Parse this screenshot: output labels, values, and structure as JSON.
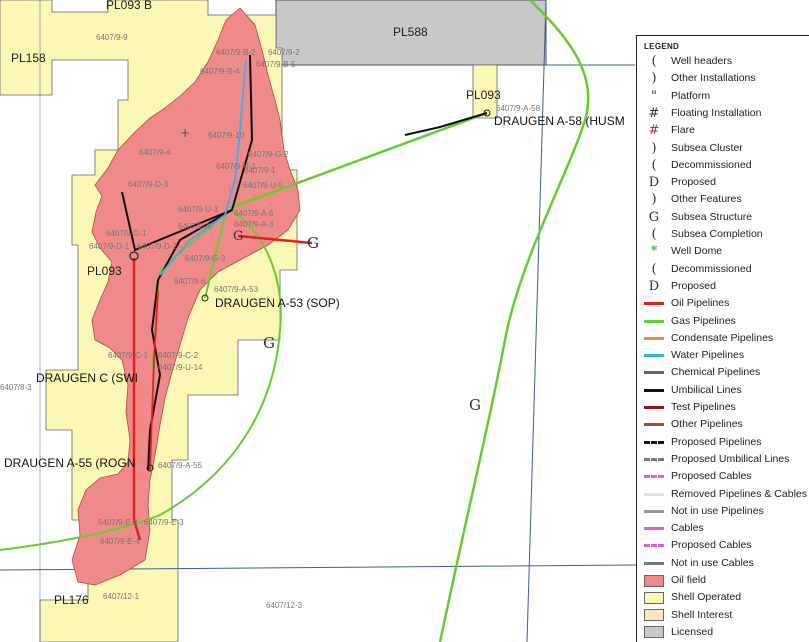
{
  "map": {
    "field_labels": {
      "draugen_a58": "DRAUGEN A-58 (HUSM",
      "draugen_a53": "DRAUGEN A-53  (SOP)",
      "draugen_c": "DRAUGEN C (SWI",
      "draugen_a55": "DRAUGEN A-55  (ROGN"
    },
    "licence_labels": {
      "pl093_top": "PL093 B",
      "pl158": "PL158",
      "pl588": "PL588",
      "pl093_right": "PL093",
      "pl093_left": "PL093",
      "pl176": "PL176"
    },
    "well_labels": {
      "w1": "6407/9-9",
      "w2": "6407/9-B-2",
      "w3": "6407/9-2",
      "w4": "6407/9-B-4",
      "w5": "6407/9-B-5",
      "w6": "6407/9-A-58",
      "w7": "6407/9-10",
      "w8": "6407/9-4",
      "w9": "6407/9-G-2",
      "w10": "6407/9-U-1",
      "w11": "6407/9-1",
      "w12": "6407/9-D-3",
      "w13": "6407/9-U-5",
      "w14": "6407/9-U-3",
      "w15": "6407/9-A-6",
      "w16": "6407/9-A-3",
      "w17": "6407/9-A-",
      "w18": "6407/9-G-1",
      "w19": "6407/9-D-1",
      "w20": "6407/9-D-2",
      "w21": "6407/9-G-3",
      "w22": "6407/9-6",
      "w23": "6407/9-A-53",
      "w24": "6407/9-C-1",
      "w25": "6407/9-C-2",
      "w26": "6407/9-U-14",
      "w27": "6407/8-3",
      "w28": "6407/9-A-55",
      "w29": "6407/9-E-2",
      "w30": "6407/9-E-3",
      "w31": "6407/9-E-4",
      "w32": "6407/12-1",
      "w33": "6407/12-3"
    },
    "subsea_structure_glyph": "G",
    "colors": {
      "oil_field": "#f08a8a",
      "shell_operated": "#fbf7b5",
      "licensed": "#c8c8c8",
      "oil_pipeline": "#e32020",
      "gas_pipeline": "#66cc33",
      "water_pipeline": "#3daee9",
      "umbilical_line": "#111111",
      "grid_line": "#3f5aa8"
    }
  },
  "legend": {
    "title": "LEGEND",
    "items": [
      {
        "label": "Well headers",
        "glyph": "(",
        "icon": "well-header-icon"
      },
      {
        "label": "Other Installations",
        "glyph": ")",
        "icon": "other-installations-icon"
      },
      {
        "label": "Platform",
        "glyph": "\"",
        "icon": "platform-icon"
      },
      {
        "label": "Floating Installation",
        "glyph": "#",
        "icon": "floating-installation-icon"
      },
      {
        "label": "Flare",
        "glyph": "#",
        "color": "#cc2222",
        "icon": "flare-icon"
      },
      {
        "label": "Subsea Cluster",
        "glyph": ")",
        "icon": "subsea-cluster-icon"
      },
      {
        "label": "Decommissioned",
        "glyph": "(",
        "icon": "decommissioned-icon"
      },
      {
        "label": "Proposed",
        "glyph": "D",
        "icon": "proposed-icon"
      },
      {
        "label": "Other Features",
        "glyph": ")",
        "icon": "other-features-icon"
      },
      {
        "label": "Subsea Structure",
        "glyph": "G",
        "icon": "subsea-structure-icon"
      },
      {
        "label": "Subsea Completion",
        "glyph": "(",
        "icon": "subsea-completion-icon"
      },
      {
        "label": "Well Dome",
        "glyph": "*",
        "color": "#2e9e2e",
        "icon": "well-dome-icon"
      },
      {
        "label": "Decommissioned",
        "glyph": "(",
        "icon": "decommissioned-icon"
      },
      {
        "label": "Proposed",
        "glyph": "D",
        "icon": "proposed-icon"
      },
      {
        "label": "Oil Pipelines",
        "line": "#e32020",
        "style": "solid",
        "icon": "oil-pipeline-icon"
      },
      {
        "label": "Gas Pipelines",
        "line": "#66cc33",
        "style": "solid",
        "icon": "gas-pipeline-icon"
      },
      {
        "label": "Condensate Pipelines",
        "line": "#f08a3c",
        "style": "solid",
        "icon": "condensate-pipeline-icon"
      },
      {
        "label": "Water Pipelines",
        "line": "#3daee9",
        "style": "solid",
        "icon": "water-pipeline-icon"
      },
      {
        "label": "Chemical Pipelines",
        "line": "#666666",
        "style": "solid",
        "icon": "chemical-pipeline-icon"
      },
      {
        "label": "Umbilical Lines",
        "line": "#111111",
        "style": "solid",
        "icon": "umbilical-line-icon"
      },
      {
        "label": "Test Pipelines",
        "line": "#8b1a1a",
        "style": "solid",
        "icon": "test-pipeline-icon"
      },
      {
        "label": "Other Pipelines",
        "line": "#a0522d",
        "style": "solid",
        "icon": "other-pipeline-icon"
      },
      {
        "label": "Proposed Pipelines",
        "line": "#111111",
        "style": "dashed",
        "icon": "proposed-pipeline-icon"
      },
      {
        "label": "Proposed Umbilical Lines",
        "line": "#777777",
        "style": "dashed",
        "icon": "proposed-umbilical-icon"
      },
      {
        "label": "Proposed Cables",
        "line": "#e060d0",
        "style": "dashed",
        "icon": "proposed-cable-icon"
      },
      {
        "label": "Removed Pipelines & Cables",
        "line": "#e0e0e0",
        "style": "solid",
        "icon": "removed-pipeline-icon"
      },
      {
        "label": "Not in use Pipelines",
        "line": "#999999",
        "style": "solid",
        "icon": "not-in-use-pipeline-icon"
      },
      {
        "label": "Cables",
        "line": "#e060d0",
        "style": "solid",
        "icon": "cable-icon"
      },
      {
        "label": "Proposed Cables",
        "line": "#e060d0",
        "style": "dashed",
        "icon": "proposed-cable-icon"
      },
      {
        "label": "Not in use Cables",
        "line": "#777777",
        "style": "solid",
        "icon": "not-in-use-cable-icon"
      },
      {
        "label": "Oil field",
        "swatch": "#f08a8a",
        "icon": "oil-field-icon"
      },
      {
        "label": "Shell Operated",
        "swatch": "#fbf7b5",
        "icon": "shell-operated-icon"
      },
      {
        "label": "Shell Interest",
        "swatch": "#fbe5c0",
        "icon": "shell-interest-icon"
      },
      {
        "label": "Licensed",
        "swatch": "#c8c8c8",
        "icon": "licensed-icon"
      }
    ]
  }
}
